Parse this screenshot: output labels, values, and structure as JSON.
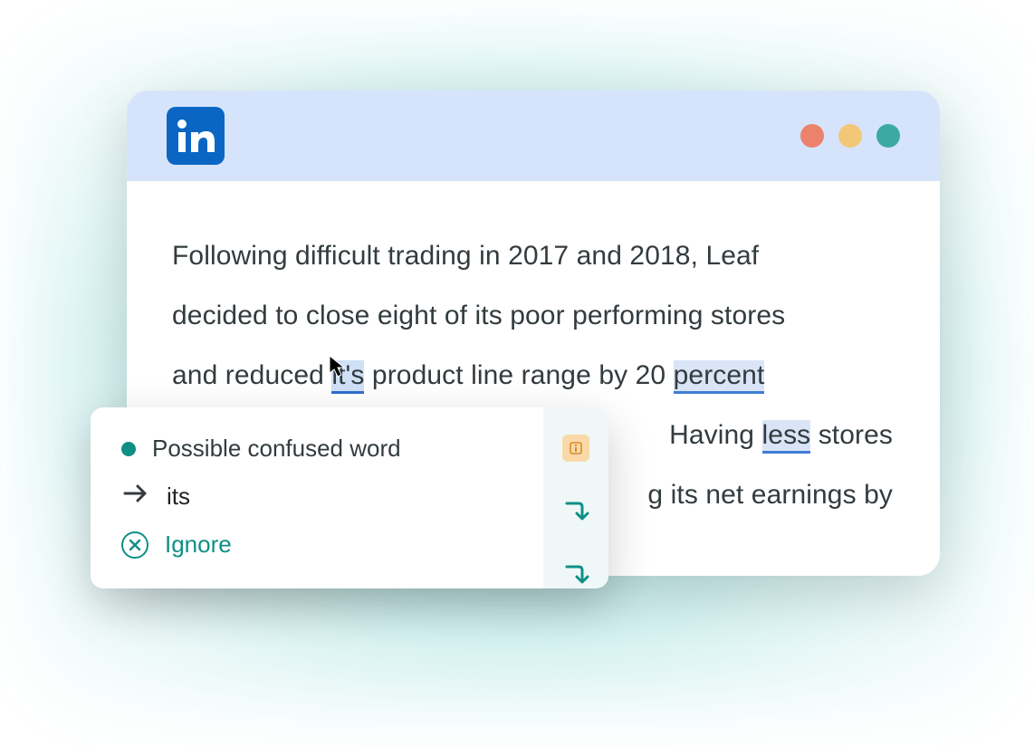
{
  "content": {
    "line1_a": "Following difficult trading in 2017 and 2018, Leaf",
    "line2_a": "decided to close eight of its poor performing stores",
    "line3_a": "and reduced ",
    "line3_hl": "it's",
    "line3_b": " product line range by 20 ",
    "line3_hl2": "percent",
    "line4_vis_a": "Having ",
    "line4_hl": "less",
    "line4_vis_b": " stores",
    "line5_vis": "g its net earnings by"
  },
  "popup": {
    "title": "Possible confused word",
    "suggestion": "its",
    "ignore": "Ignore"
  },
  "colors": {
    "teal": "#0f8f86",
    "highlight_bg": "#d9e4f6",
    "highlight_border": "#3f7dd6"
  }
}
